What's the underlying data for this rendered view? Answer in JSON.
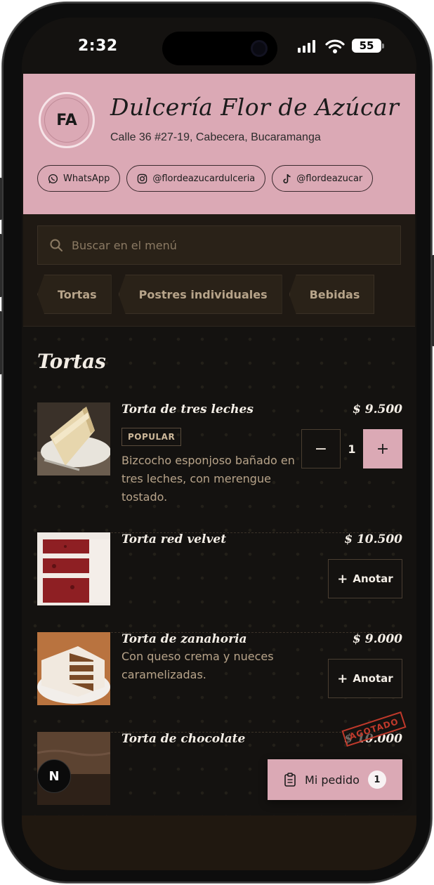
{
  "status": {
    "time": "2:32",
    "battery": "55"
  },
  "shop": {
    "initials": "FA",
    "name": "Dulcería Flor de Azúcar",
    "address": "Calle 36 #27-19, Cabecera, Bucaramanga",
    "socials": [
      {
        "icon": "whatsapp-icon",
        "label": "WhatsApp"
      },
      {
        "icon": "instagram-icon",
        "label": "@flordeazucardulceria"
      },
      {
        "icon": "tiktok-icon",
        "label": "@flordeazucar"
      }
    ]
  },
  "search": {
    "placeholder": "Buscar en el menú"
  },
  "categories": [
    "Tortas",
    "Postres individuales",
    "Bebidas"
  ],
  "section": {
    "title": "Tortas"
  },
  "items": [
    {
      "name": "Torta de tres leches",
      "price": "$ 9.500",
      "badge": "POPULAR",
      "description": "Bizcocho esponjoso bañado en tres leches, con merengue tostado.",
      "quantity": "1"
    },
    {
      "name": "Torta red velvet",
      "price": "$ 10.500",
      "action": "Anotar"
    },
    {
      "name": "Torta de zanahoria",
      "price": "$ 9.000",
      "description": "Con queso crema y nueces caramelizadas.",
      "action": "Anotar"
    },
    {
      "name": "Torta de chocolate",
      "price": "$ 10.000",
      "stamp": "AGOTADO"
    }
  ],
  "order": {
    "label": "Mi pedido",
    "count": "1"
  },
  "dev_badge": "N",
  "colors": {
    "brand_pink": "#dba9b5",
    "background": "#141210",
    "panel": "#1f1913",
    "sold_out": "#c0392b"
  }
}
